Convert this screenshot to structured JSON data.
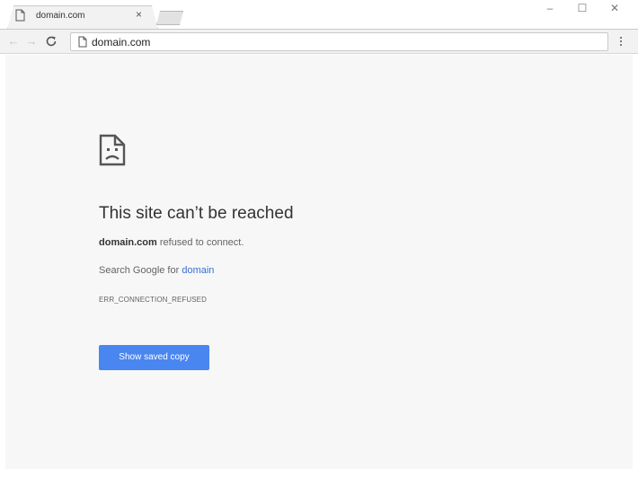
{
  "tab": {
    "title": "domain.com",
    "close": "×"
  },
  "window_controls": {
    "minimize": "–",
    "maximize": "☐",
    "close": "✕"
  },
  "toolbar": {
    "back": "←",
    "forward": "→",
    "reload": "C",
    "url": "domain.com"
  },
  "error": {
    "title": "This site can’t be reached",
    "host": "domain.com",
    "message": " refused to connect.",
    "search_prefix": "Search Google for ",
    "search_term": "domain",
    "code": "ERR_CONNECTION_REFUSED",
    "button_label": "Show saved copy"
  },
  "colors": {
    "accent_button": "#4a86f0",
    "link": "#3b6fd4",
    "page_background": "#f7f7f7"
  }
}
